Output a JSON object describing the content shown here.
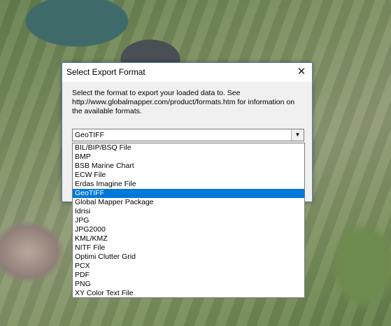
{
  "dialog": {
    "title": "Select Export Format",
    "close_glyph": "✕",
    "description": "Select the format to export your loaded data to. See http://www.globalmapper.com/product/formats.htm for information on the available formats.",
    "combo": {
      "selected": "GeoTIFF",
      "arrow_icon": "chevron-down-icon"
    },
    "formats": [
      "BIL/BIP/BSQ File",
      "BMP",
      "BSB Marine Chart",
      "ECW File",
      "Erdas Imagine File",
      "GeoTIFF",
      "Global Mapper Package",
      "Idrisi",
      "JPG",
      "JPG2000",
      "KML/KMZ",
      "NITF File",
      "Optimi Clutter Grid",
      "PCX",
      "PDF",
      "PNG",
      "XY Color Text File"
    ],
    "selected_index": 5
  },
  "colors": {
    "selection": "#0078d7",
    "dialog_border": "#5a7fa6"
  }
}
